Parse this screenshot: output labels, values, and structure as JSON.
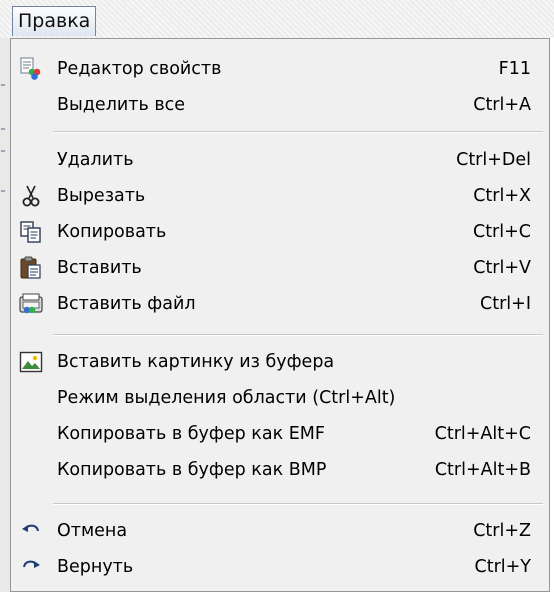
{
  "menu": {
    "title": "Правка",
    "groups": [
      {
        "items": [
          {
            "label": "Редактор свойств",
            "shortcut": "F11",
            "icon": "property-editor-icon"
          },
          {
            "label": "Выделить все",
            "shortcut": "Ctrl+A",
            "icon": ""
          }
        ]
      },
      {
        "items": [
          {
            "label": "Удалить",
            "shortcut": "Ctrl+Del",
            "icon": ""
          },
          {
            "label": "Вырезать",
            "shortcut": "Ctrl+X",
            "icon": "scissors-icon"
          },
          {
            "label": "Копировать",
            "shortcut": "Ctrl+C",
            "icon": "copy-icon"
          },
          {
            "label": "Вставить",
            "shortcut": "Ctrl+V",
            "icon": "paste-icon"
          },
          {
            "label": "Вставить файл",
            "shortcut": "Ctrl+I",
            "icon": "insert-file-icon"
          }
        ]
      },
      {
        "items": [
          {
            "label": "Вставить картинку из буфера",
            "shortcut": "",
            "icon": "insert-picture-icon"
          },
          {
            "label": "Режим выделения области (Ctrl+Alt)",
            "shortcut": "",
            "icon": ""
          },
          {
            "label": "Копировать в буфер как EMF",
            "shortcut": "Ctrl+Alt+C",
            "icon": ""
          },
          {
            "label": "Копировать в буфер как BMP",
            "shortcut": "Ctrl+Alt+B",
            "icon": ""
          }
        ]
      },
      {
        "items": [
          {
            "label": "Отмена",
            "shortcut": "Ctrl+Z",
            "icon": "undo-icon"
          },
          {
            "label": "Вернуть",
            "shortcut": "Ctrl+Y",
            "icon": "redo-icon"
          }
        ]
      }
    ]
  },
  "colors": {
    "menu_background": "#f0f0f0",
    "menu_border": "#979797",
    "title_border": "#6f86a3"
  }
}
